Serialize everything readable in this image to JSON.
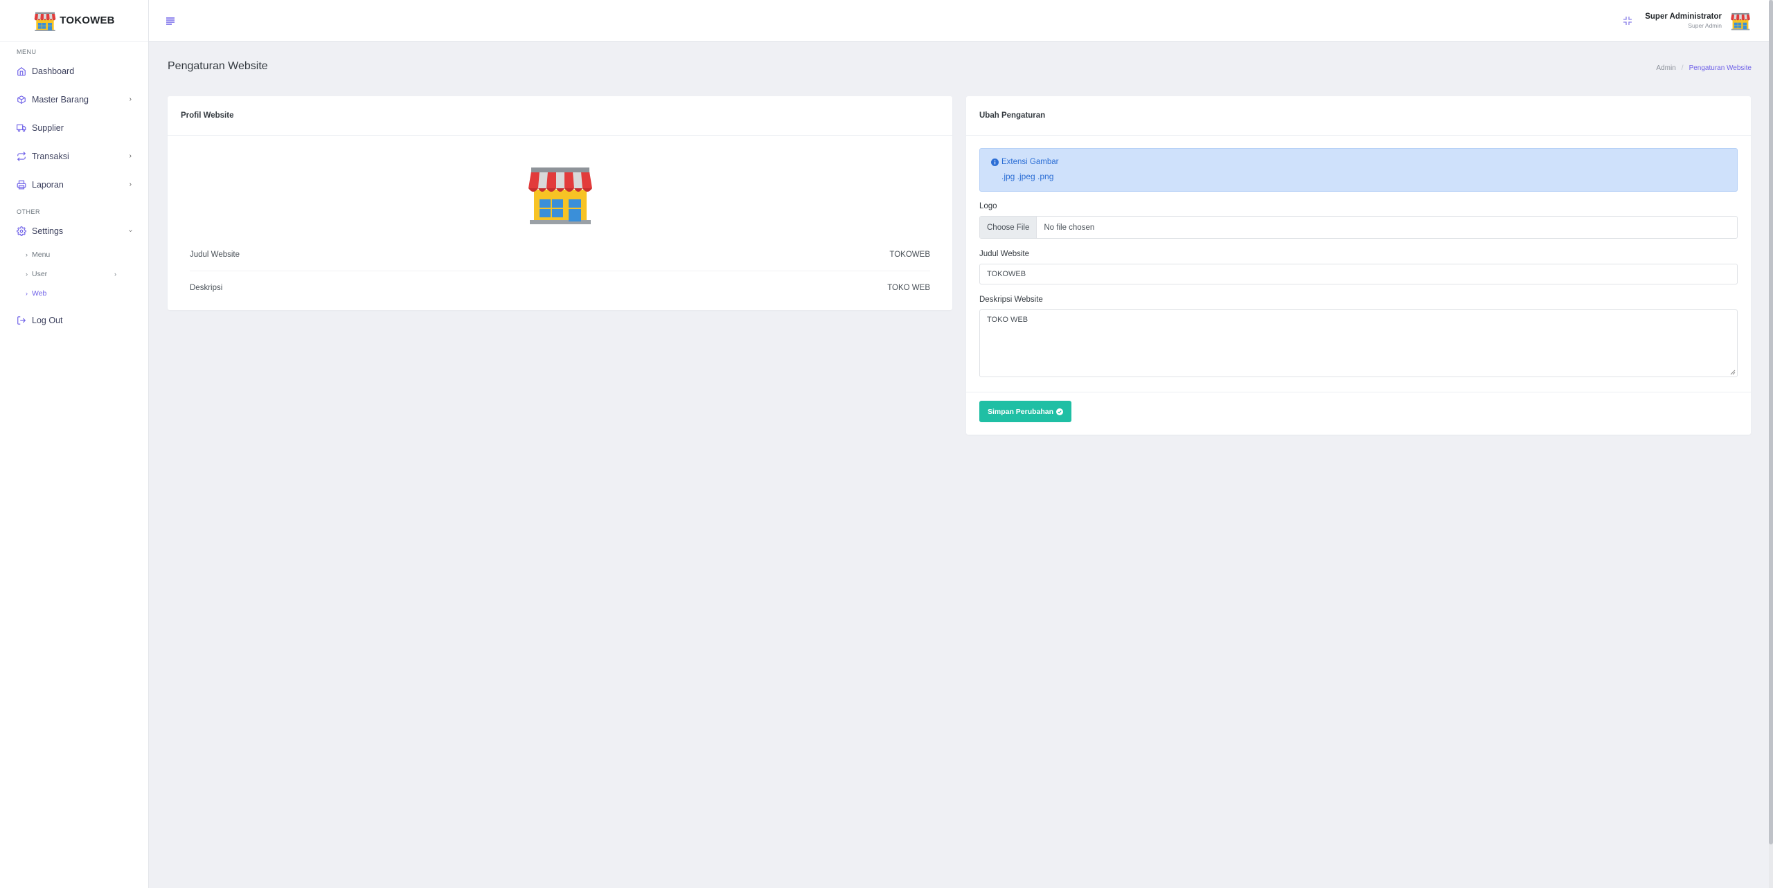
{
  "brand": {
    "name": "TOKOWEB",
    "logo_icon": "shop-icon"
  },
  "sidebar": {
    "section_menu": "MENU",
    "section_other": "OTHER",
    "items": [
      {
        "label": "Dashboard",
        "icon": "home-icon"
      },
      {
        "label": "Master Barang",
        "icon": "box-icon"
      },
      {
        "label": "Supplier",
        "icon": "truck-icon"
      },
      {
        "label": "Transaksi",
        "icon": "repeat-icon"
      },
      {
        "label": "Laporan",
        "icon": "printer-icon"
      }
    ],
    "settings": {
      "label": "Settings",
      "icon": "gear-icon",
      "sub": [
        {
          "label": "Menu"
        },
        {
          "label": "User"
        },
        {
          "label": "Web"
        }
      ]
    },
    "logout": {
      "label": "Log Out",
      "icon": "logout-icon"
    }
  },
  "topbar": {
    "user_name": "Super Administrator",
    "user_role": "Super Admin"
  },
  "page": {
    "title": "Pengaturan Website",
    "breadcrumb": [
      "Admin",
      "Pengaturan Website"
    ]
  },
  "profile_card": {
    "title": "Profil Website",
    "rows": [
      {
        "label": "Judul Website",
        "value": "TOKOWEB"
      },
      {
        "label": "Deskripsi",
        "value": "TOKO WEB"
      }
    ]
  },
  "settings_card": {
    "title": "Ubah Pengaturan",
    "alert_title": "Extensi Gambar",
    "alert_text": ".jpg .jpeg .png",
    "logo_label": "Logo",
    "file_button": "Choose File",
    "file_status": "No file chosen",
    "judul_label": "Judul Website",
    "judul_value": "TOKOWEB",
    "deskripsi_label": "Deskripsi Website",
    "deskripsi_value": "TOKO WEB",
    "save_label": "Simpan Perubahan"
  },
  "colors": {
    "accent": "#6f61e8",
    "success": "#1fbfa4",
    "alert_bg": "#cfe1fb"
  }
}
